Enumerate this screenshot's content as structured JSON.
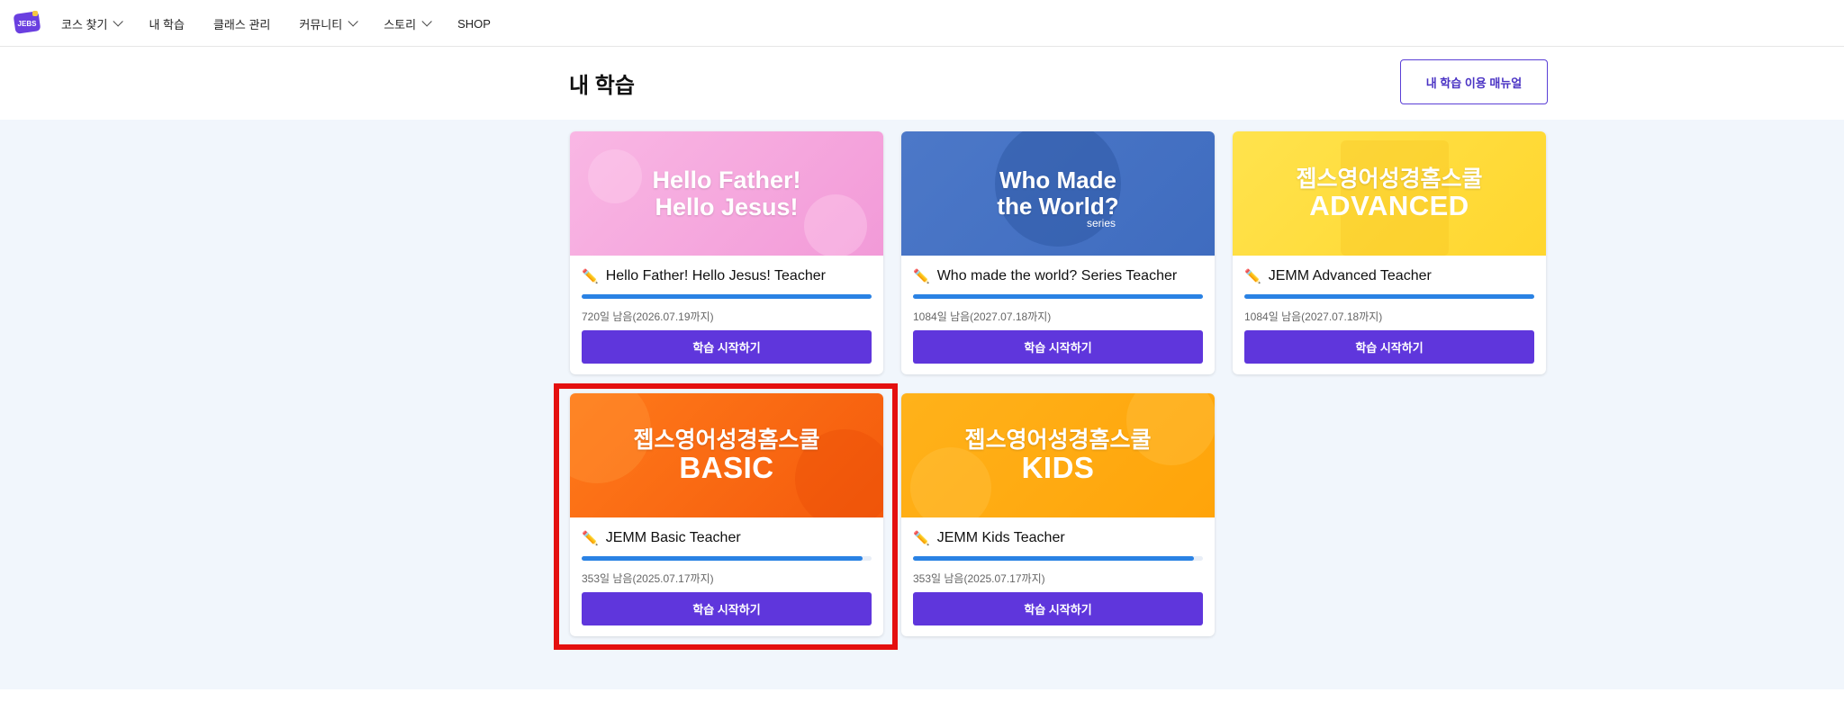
{
  "nav": {
    "logo_text": "JEBS",
    "items": [
      {
        "label": "코스 찾기",
        "dropdown": true
      },
      {
        "label": "내 학습",
        "dropdown": false
      },
      {
        "label": "클래스 관리",
        "dropdown": false
      },
      {
        "label": "커뮤니티",
        "dropdown": true
      },
      {
        "label": "스토리",
        "dropdown": true
      },
      {
        "label": "SHOP",
        "dropdown": false
      }
    ]
  },
  "header": {
    "title": "내 학습",
    "manual_button": "내 학습 이용 매뉴얼"
  },
  "colors": {
    "accent": "#5f36dc",
    "progress": "#2a82e4",
    "highlight": "#e4100f",
    "background": "#f1f6fc"
  },
  "courses": [
    {
      "thumb_line1": "Hello Father!",
      "thumb_line2": "Hello Jesus!",
      "title": "Hello Father! Hello Jesus! Teacher",
      "progress": 1.0,
      "remaining": "720일 남음(2026.07.19까지)",
      "button": "학습 시작하기",
      "icon": "pencil-icon"
    },
    {
      "thumb_line1": "Who Made",
      "thumb_line2": "the World?",
      "thumb_sub": "series",
      "title": "Who made the world? Series Teacher",
      "progress": 1.0,
      "remaining": "1084일 남음(2027.07.18까지)",
      "button": "학습 시작하기",
      "icon": "pencil-icon"
    },
    {
      "thumb_line1": "젭스영어성경홈스쿨",
      "thumb_line2": "ADVANCED",
      "title": "JEMM Advanced Teacher",
      "progress": 1.0,
      "remaining": "1084일 남음(2027.07.18까지)",
      "button": "학습 시작하기",
      "icon": "pencil-icon"
    },
    {
      "thumb_line1": "젭스영어성경홈스쿨",
      "thumb_line2": "BASIC",
      "title": "JEMM Basic Teacher",
      "progress": 0.97,
      "remaining": "353일 남음(2025.07.17까지)",
      "button": "학습 시작하기",
      "icon": "pencil-icon",
      "highlighted": true
    },
    {
      "thumb_line1": "젭스영어성경홈스쿨",
      "thumb_line2": "KIDS",
      "title": "JEMM Kids Teacher",
      "progress": 0.97,
      "remaining": "353일 남음(2025.07.17까지)",
      "button": "학습 시작하기",
      "icon": "pencil-icon"
    }
  ]
}
